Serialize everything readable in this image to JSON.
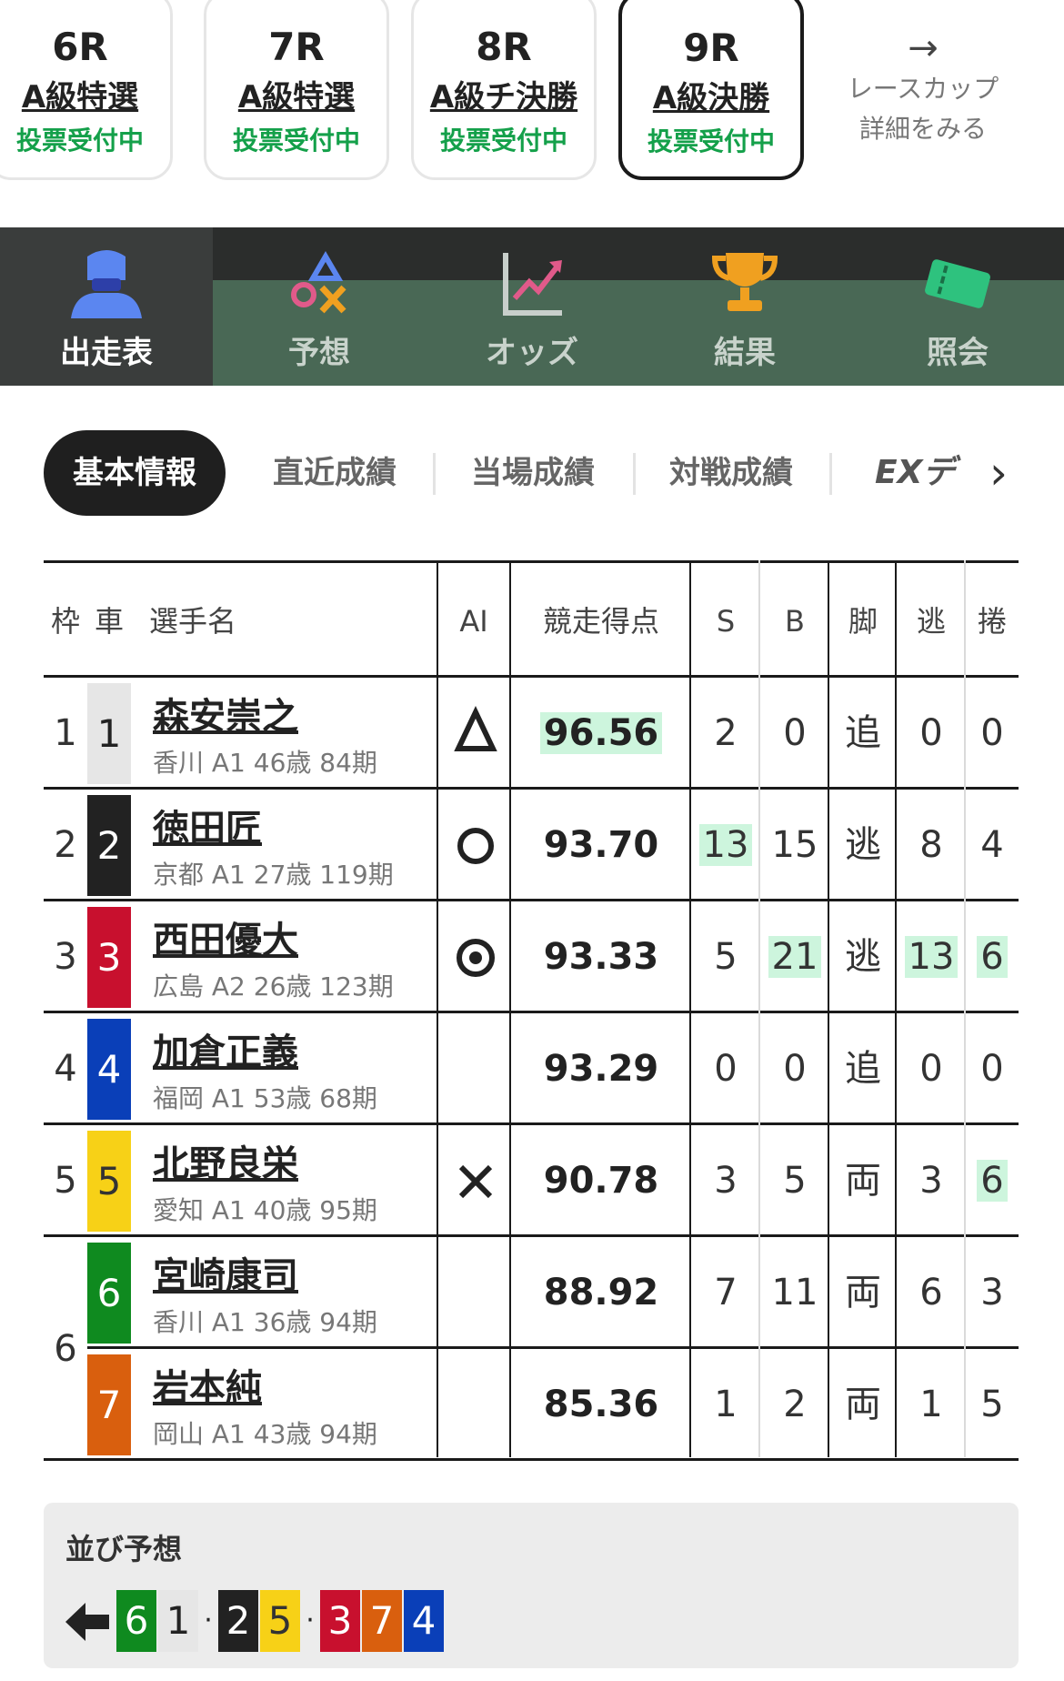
{
  "race_tabs": [
    {
      "num": "6R",
      "name": "A級特選",
      "status": "投票受付中",
      "active": false
    },
    {
      "num": "7R",
      "name": "A級特選",
      "status": "投票受付中",
      "active": false
    },
    {
      "num": "8R",
      "name": "A級チ決勝",
      "status": "投票受付中",
      "active": false
    },
    {
      "num": "9R",
      "name": "A級決勝",
      "status": "投票受付中",
      "active": true
    }
  ],
  "cup_link": {
    "line1": "レースカップ",
    "line2": "詳細をみる",
    "icon": "arrow-right-icon"
  },
  "nav": [
    {
      "label": "出走表",
      "icon": "racer-helmet-icon",
      "active": true
    },
    {
      "label": "予想",
      "icon": "prediction-marks-icon",
      "active": false
    },
    {
      "label": "オッズ",
      "icon": "odds-chart-icon",
      "active": false
    },
    {
      "label": "結果",
      "icon": "trophy-icon",
      "active": false
    },
    {
      "label": "照会",
      "icon": "ticket-icon",
      "active": false
    }
  ],
  "subtabs": [
    {
      "label": "基本情報",
      "active": true
    },
    {
      "label": "直近成績",
      "active": false
    },
    {
      "label": "当場成績",
      "active": false
    },
    {
      "label": "対戦成績",
      "active": false
    },
    {
      "label": "EXデ",
      "active": false
    }
  ],
  "table": {
    "headers": {
      "waku": "枠",
      "car": "車",
      "name": "選手名",
      "ai": "AI",
      "score": "競走得点",
      "s": "S",
      "b": "B",
      "leg": "脚",
      "nige": "逃",
      "makuri": "捲"
    },
    "rows": [
      {
        "waku": "1",
        "car": "1",
        "name": "森安崇之",
        "info": "香川 A1 46歳 84期",
        "ai": "triangle",
        "score": "96.56",
        "score_hl": true,
        "s": "2",
        "b": "0",
        "leg": "追",
        "nige": "0",
        "makuri": "0",
        "hl": []
      },
      {
        "waku": "2",
        "car": "2",
        "name": "徳田匠",
        "info": "京都 A1 27歳 119期",
        "ai": "circle",
        "score": "93.70",
        "score_hl": false,
        "s": "13",
        "b": "15",
        "leg": "逃",
        "nige": "8",
        "makuri": "4",
        "hl": [
          "s"
        ]
      },
      {
        "waku": "3",
        "car": "3",
        "name": "西田優大",
        "info": "広島 A2 26歳 123期",
        "ai": "double-circle",
        "score": "93.33",
        "score_hl": false,
        "s": "5",
        "b": "21",
        "leg": "逃",
        "nige": "13",
        "makuri": "6",
        "hl": [
          "b",
          "nige",
          "makuri"
        ]
      },
      {
        "waku": "4",
        "car": "4",
        "name": "加倉正義",
        "info": "福岡 A1 53歳 68期",
        "ai": "",
        "score": "93.29",
        "score_hl": false,
        "s": "0",
        "b": "0",
        "leg": "追",
        "nige": "0",
        "makuri": "0",
        "hl": []
      },
      {
        "waku": "5",
        "car": "5",
        "name": "北野良栄",
        "info": "愛知 A1 40歳 95期",
        "ai": "cross",
        "score": "90.78",
        "score_hl": false,
        "s": "3",
        "b": "5",
        "leg": "両",
        "nige": "3",
        "makuri": "6",
        "hl": [
          "makuri"
        ]
      },
      {
        "waku": "6",
        "car": "6",
        "name": "宮崎康司",
        "info": "香川 A1 36歳 94期",
        "ai": "",
        "score": "88.92",
        "score_hl": false,
        "s": "7",
        "b": "11",
        "leg": "両",
        "nige": "6",
        "makuri": "3",
        "hl": []
      },
      {
        "waku": "",
        "car": "7",
        "name": "岩本純",
        "info": "岡山 A1 43歳 94期",
        "ai": "",
        "score": "85.36",
        "score_hl": false,
        "s": "1",
        "b": "2",
        "leg": "両",
        "nige": "1",
        "makuri": "5",
        "hl": []
      }
    ]
  },
  "car_colors": {
    "1": {
      "bg": "#e6e6e6",
      "fg": "#222222"
    },
    "2": {
      "bg": "#222222",
      "fg": "#ffffff"
    },
    "3": {
      "bg": "#c8102e",
      "fg": "#ffffff"
    },
    "4": {
      "bg": "#0a3fb8",
      "fg": "#ffffff"
    },
    "5": {
      "bg": "#f7d117",
      "fg": "#333333"
    },
    "6": {
      "bg": "#0f8a1f",
      "fg": "#ffffff"
    },
    "7": {
      "bg": "#d95f0e",
      "fg": "#ffffff"
    }
  },
  "narabi": {
    "title": "並び予想",
    "icon": "arrow-left-icon",
    "sequence": [
      "6",
      "1",
      "·",
      "2",
      "5",
      "·",
      "3",
      "7",
      "4"
    ]
  },
  "colors": {
    "accent_green": "#14a04a",
    "nav_bg": "#496855",
    "highlight": "#cdf5dd"
  }
}
